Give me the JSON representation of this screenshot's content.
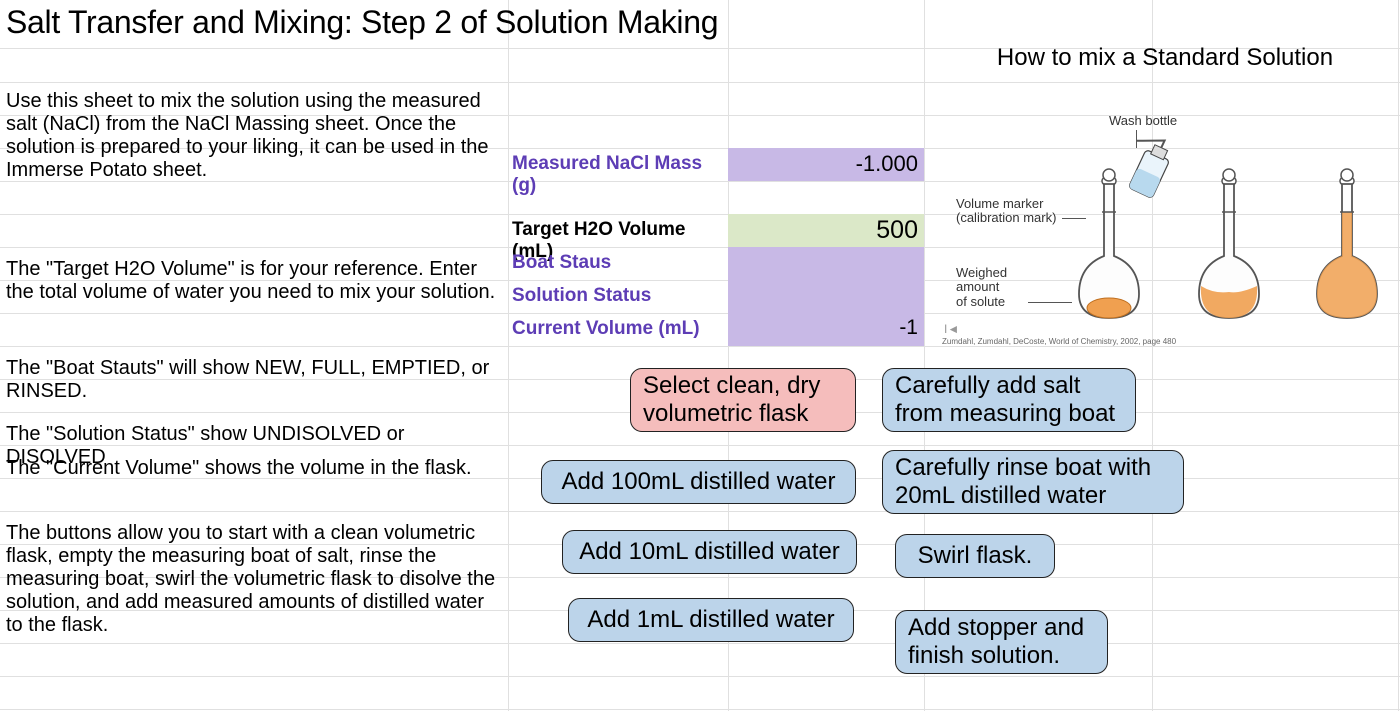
{
  "title": "Salt Transfer and Mixing: Step 2 of Solution Making",
  "instructions": {
    "p1": "Use this sheet to mix the solution using the measured salt (NaCl) from the NaCl Massing sheet. Once the solution is prepared to your liking, it can be used in the Immerse Potato sheet.",
    "p2": "The \"Target H2O Volume\" is for your reference.  Enter the total volume of water you need to mix your solution.",
    "p3": "The \"Boat Stauts\" will show NEW, FULL, EMPTIED, or RINSED.",
    "p4": "The \"Solution Status\" show UNDISOLVED or DISOLVED",
    "p5": "The \"Current Volume\" shows the volume in the flask.",
    "p6": "The buttons allow you to start with a clean volumetric flask, empty the measuring boat of salt, rinse the measuring boat, swirl the volumetric flask to disolve the solution, and add measured amounts of distilled water to the flask."
  },
  "fields": {
    "nacl_mass_label": "Measured NaCl Mass (g)",
    "nacl_mass_value": "-1.000",
    "target_vol_label": "Target H2O Volume (mL)",
    "target_vol_value": "500",
    "boat_status_label": "Boat Staus",
    "boat_status_value": "",
    "solution_status_label": "Solution Status",
    "solution_status_value": "",
    "current_vol_label": "Current Volume (mL)",
    "current_vol_value": "-1"
  },
  "buttons": {
    "select_flask": "Select clean, dry volumetric flask",
    "add_salt": "Carefully add salt from measuring boat",
    "add_100": "Add 100mL distilled water",
    "rinse_boat": "Carefully rinse boat with 20mL distilled water",
    "add_10": "Add 10mL distilled water",
    "swirl": "Swirl flask.",
    "add_1": "Add 1mL distilled water",
    "add_stopper": "Add stopper and finish solution."
  },
  "diagram": {
    "title": "How to mix a Standard Solution",
    "wash_bottle": "Wash bottle",
    "volume_marker_line1": "Volume marker",
    "volume_marker_line2": "(calibration mark)",
    "weighed_line1": "Weighed",
    "weighed_line2": "amount",
    "weighed_line3": "of solute",
    "citation": "Zumdahl, Zumdahl, DeCoste, World of Chemistry, 2002, page 480"
  }
}
